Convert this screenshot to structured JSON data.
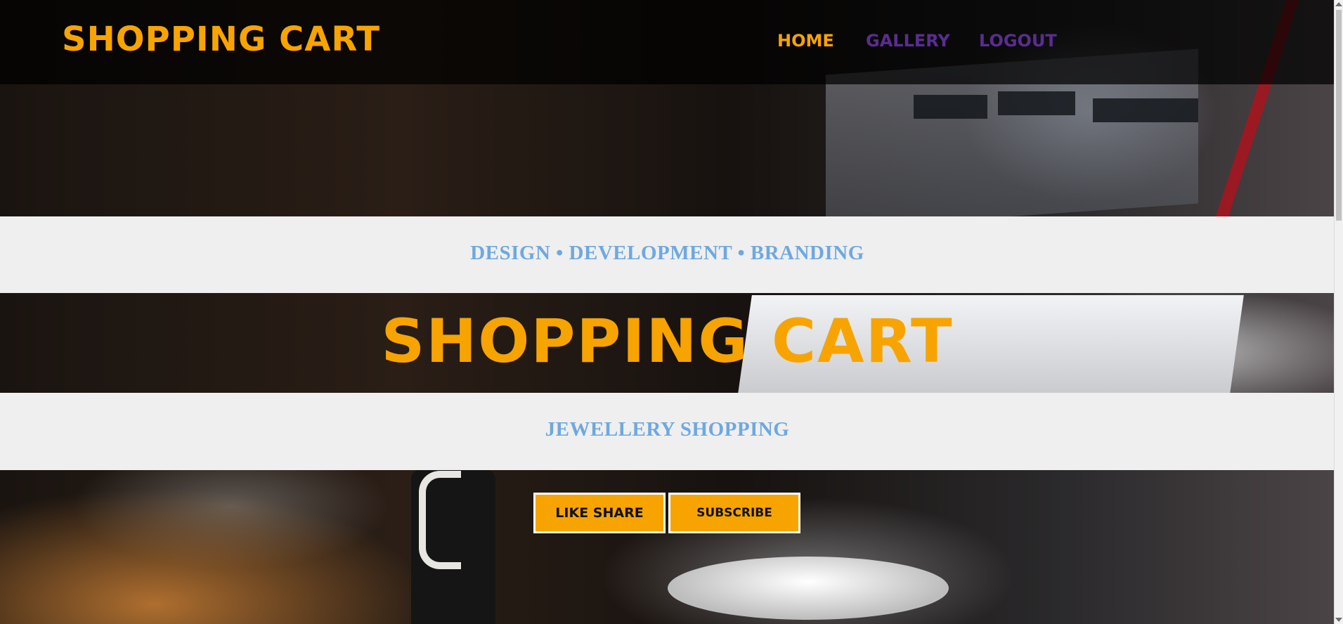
{
  "navbar": {
    "brand": "SHOPPING CART",
    "links": [
      {
        "label": "HOME",
        "color": "#f7a400"
      },
      {
        "label": "GALLERY",
        "color": "#5a2d91"
      },
      {
        "label": "LOGOUT",
        "color": "#5a2d91"
      }
    ]
  },
  "tagline": "DESIGN • DEVELOPMENT • BRANDING",
  "hero": {
    "title": "SHOPPING CART"
  },
  "subheading": "JEWELLERY SHOPPING",
  "buttons": {
    "like_share": "LIKE SHARE",
    "subscribe": "SUBSCRIBE"
  },
  "colors": {
    "accent": "#f7a400",
    "nav_secondary": "#5a2d91",
    "band_text": "#6ea8e0",
    "band_bg": "#efefef"
  }
}
